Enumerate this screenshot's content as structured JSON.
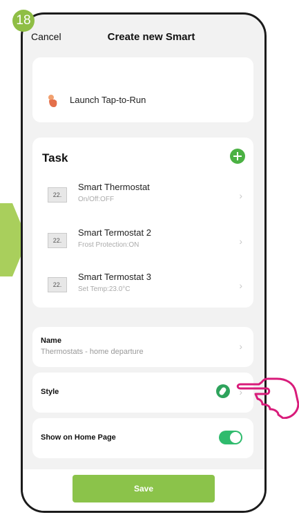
{
  "step": {
    "number": "18"
  },
  "header": {
    "cancel_label": "Cancel",
    "title": "Create new Smart"
  },
  "launch": {
    "label": "Launch Tap-to-Run"
  },
  "task": {
    "title": "Task",
    "items": [
      {
        "icon_text": "22.",
        "name": "Smart Thermostat",
        "detail": "On/Off:OFF"
      },
      {
        "icon_text": "22.",
        "name": "Smart Termostat 2",
        "detail": "Frost Protection:ON"
      },
      {
        "icon_text": "22.",
        "name": "Smart Termostat 3",
        "detail": "Set Temp:23.0°C"
      }
    ]
  },
  "settings": {
    "name_label": "Name",
    "name_value": "Thermostats - home departure",
    "style_label": "Style",
    "home_label": "Show on Home Page"
  },
  "footer": {
    "save_label": "Save"
  },
  "colors": {
    "accent_green": "#8bc34a",
    "add_green": "#4bb143",
    "toggle_green": "#2fbb6d",
    "pointer_pink": "#d81b7a",
    "arrow_green": "#a9cf5c"
  },
  "icons": {
    "launch": "hand-tap-icon",
    "add": "plus-circle-icon",
    "device": "thermostat-icon",
    "chevron": "chevron-right-icon",
    "style": "leaf-style-icon",
    "pointer": "pointing-hand-icon"
  }
}
